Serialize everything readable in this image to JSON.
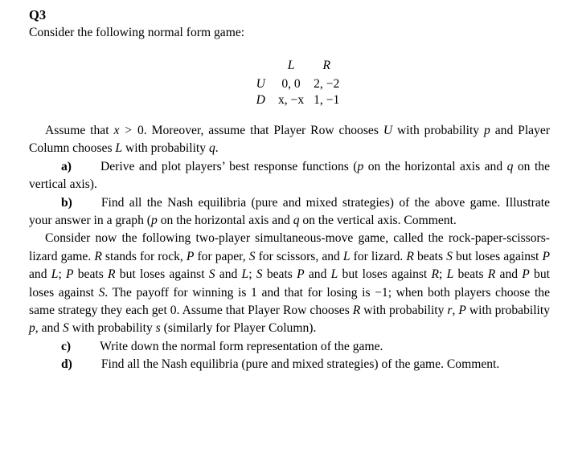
{
  "document": {
    "heading": "Q3",
    "intro": "Consider the following normal form game:",
    "matrix": {
      "corner": "",
      "column_headers": [
        "L",
        "R"
      ],
      "row_headers": [
        "U",
        "D"
      ],
      "cells": [
        [
          "0, 0",
          "2, −2"
        ],
        [
          "x, −x",
          "1, −1"
        ]
      ]
    },
    "assume_paragraph": {
      "part1": "Assume that ",
      "var_x": "x",
      "gt": " > ",
      "zero": "0",
      "part2": ". Moreover, assume that Player Row chooses ",
      "var_U": "U",
      "part3": " with probability ",
      "var_p": "p",
      "part4": " and Player Column chooses ",
      "var_L": "L",
      "part5": " with probability ",
      "var_q": "q",
      "part6": "."
    },
    "items": [
      {
        "label": "a)",
        "text_1": "Derive and plot players’ best response functions (",
        "var_1": "p",
        "text_2": " on the horizontal axis and ",
        "var_2": "q",
        "text_3": " on the vertical axis)."
      },
      {
        "label": "b)",
        "text_1": "Find all the Nash equilibria (pure and mixed strategies) of the above game. Illustrate your answer in a graph (",
        "var_1": "p",
        "text_2": " on the horizontal axis and ",
        "var_2": "q",
        "text_3": " on the vertical axis. Comment."
      }
    ],
    "rpsl_paragraph": {
      "s1": "Consider now the following two-player simultaneous-move game, called the rock-paper-scissors-lizard game. ",
      "v_R1": "R",
      "s2": " stands for rock, ",
      "v_P1": "P",
      "s3": " for paper, ",
      "v_S1": "S",
      "s4": " for scissors, and ",
      "v_L1": "L",
      "s5": " for lizard. ",
      "v_R2": "R",
      "s6": " beats ",
      "v_S2": "S",
      "s7": " but loses against ",
      "v_P2": "P",
      "s8": " and ",
      "v_L2": "L",
      "s9": "; ",
      "v_P3": "P",
      "s10": " beats ",
      "v_R3": "R",
      "s11": " but loses against ",
      "v_S3": "S",
      "s12": " and ",
      "v_L3": "L",
      "s13": "; ",
      "v_S4": "S",
      "s14": " beats ",
      "v_P4": "P",
      "s15": " and ",
      "v_L4": "L",
      "s16": " but loses against ",
      "v_R4": "R",
      "s17": "; ",
      "v_L5": "L",
      "s18": " beats ",
      "v_R5": "R",
      "s19": " and ",
      "v_P5": "P",
      "s20": " but loses against ",
      "v_S5": "S",
      "s21": ". The payoff for winning is 1 and that for losing is −1; when both players choose the same strategy they each get 0. Assume that Player Row chooses ",
      "v_R6": "R",
      "s22": " with probability ",
      "v_r": "r",
      "s23": ", ",
      "v_P6": "P",
      "s24": " with probability ",
      "v_p": "p",
      "s25": ", and ",
      "v_S6": "S",
      "s26": " with probability ",
      "v_s": "s",
      "s27": " (similarly for Player Column)."
    },
    "items2": [
      {
        "label": "c)",
        "text_1": "Write down the normal form representation of the game."
      },
      {
        "label": "d)",
        "text_1": "Find all the Nash equilibria (pure and mixed strategies) of the game. Comment."
      }
    ]
  }
}
